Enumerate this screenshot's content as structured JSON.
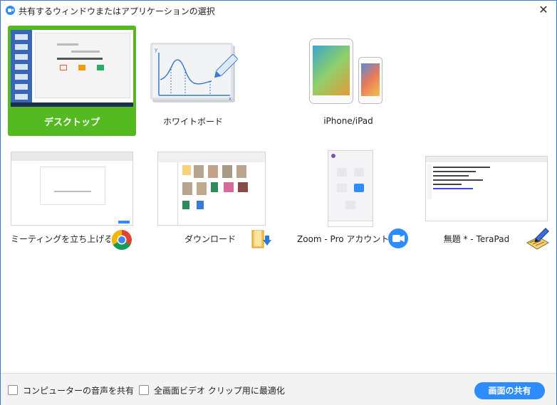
{
  "window": {
    "title": "共有するウィンドウまたはアプリケーションの選択",
    "close_glyph": "✕"
  },
  "sources": [
    {
      "label": "デスクトップ",
      "kind": "desktop",
      "selected": true
    },
    {
      "label": "ホワイトボード",
      "kind": "whiteboard",
      "selected": false
    },
    {
      "label": "iPhone/iPad",
      "kind": "device",
      "selected": false
    },
    {
      "label": "ミーティングを立ち上げる -...",
      "kind": "window",
      "app_icon": "chrome-icon",
      "selected": false
    },
    {
      "label": "ダウンロード",
      "kind": "window",
      "app_icon": "folder-download-icon",
      "selected": false
    },
    {
      "label": "Zoom - Pro アカウント",
      "kind": "window",
      "app_icon": "zoom-icon",
      "selected": false
    },
    {
      "label": "無題 * - TeraPad",
      "kind": "window",
      "app_icon": "terapad-icon",
      "selected": false
    }
  ],
  "footer": {
    "share_audio_label": "コンピューターの音声を共有",
    "share_audio_checked": false,
    "optimize_video_label": "全画面ビデオ クリップ用に最適化",
    "optimize_video_checked": false,
    "share_button_label": "画面の共有"
  },
  "colors": {
    "selected_tile": "#55b921",
    "accent": "#2d8cff",
    "window_border": "#3a78c9"
  }
}
